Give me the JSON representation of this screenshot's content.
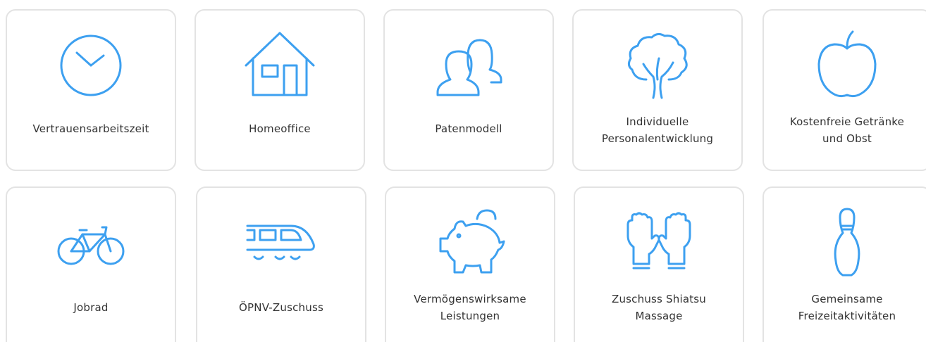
{
  "accent_color": "#3da0f0",
  "benefits": [
    {
      "label": "Vertrauensarbeitszeit",
      "icon": "clock-icon"
    },
    {
      "label": "Homeoffice",
      "icon": "house-icon"
    },
    {
      "label": "Patenmodell",
      "icon": "people-icon"
    },
    {
      "label": "Individuelle\nPersonalentwicklung",
      "icon": "tree-icon"
    },
    {
      "label": "Kostenfreie Getränke\nund Obst",
      "icon": "apple-icon"
    },
    {
      "label": "Jobrad",
      "icon": "bicycle-icon"
    },
    {
      "label": "ÖPNV-Zuschuss",
      "icon": "train-icon"
    },
    {
      "label": "Vermögenswirksame\nLeistungen",
      "icon": "piggy-bank-icon"
    },
    {
      "label": "Zuschuss Shiatsu\nMassage",
      "icon": "hands-icon"
    },
    {
      "label": "Gemeinsame\nFreizeitaktivitäten",
      "icon": "bowling-pin-icon"
    }
  ]
}
